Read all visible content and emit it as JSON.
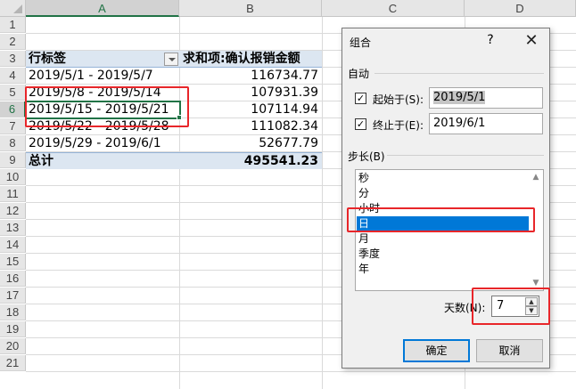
{
  "spreadsheet": {
    "columns": [
      "A",
      "B",
      "C",
      "D"
    ],
    "rows": [
      "1",
      "2",
      "3",
      "4",
      "5",
      "6",
      "7",
      "8",
      "9",
      "10",
      "11",
      "12",
      "13",
      "14",
      "15",
      "16",
      "17",
      "18",
      "19",
      "20",
      "21"
    ],
    "pivot": {
      "header_row_label": "行标签",
      "header_value_label": "求和项:确认报销金额",
      "rows": [
        {
          "label": "2019/5/1 - 2019/5/7",
          "value": "116734.77"
        },
        {
          "label": "2019/5/8 - 2019/5/14",
          "value": "107931.39"
        },
        {
          "label": "2019/5/15 - 2019/5/21",
          "value": "107114.94"
        },
        {
          "label": "2019/5/22 - 2019/5/28",
          "value": "111082.34"
        },
        {
          "label": "2019/5/29 - 2019/6/1",
          "value": "52677.79"
        }
      ],
      "total_label": "总计",
      "total_value": "495541.23"
    }
  },
  "dialog": {
    "title": "组合",
    "help": "?",
    "close": "✕",
    "auto_section": "自动",
    "start_label": "起始于(S):",
    "start_value": "2019/5/1",
    "start_checked": true,
    "end_label": "终止于(E):",
    "end_value": "2019/6/1",
    "end_checked": true,
    "step_section": "步长(B)",
    "step_items": [
      "秒",
      "分",
      "小时",
      "日",
      "月",
      "季度",
      "年"
    ],
    "step_selected": "日",
    "days_label": "天数(N):",
    "days_value": "7",
    "ok_label": "确定",
    "cancel_label": "取消"
  },
  "colors": {
    "accent_green": "#217346",
    "highlight_red": "#e8262a",
    "selection_blue": "#0078d7",
    "pivot_band": "#dce6f1"
  }
}
